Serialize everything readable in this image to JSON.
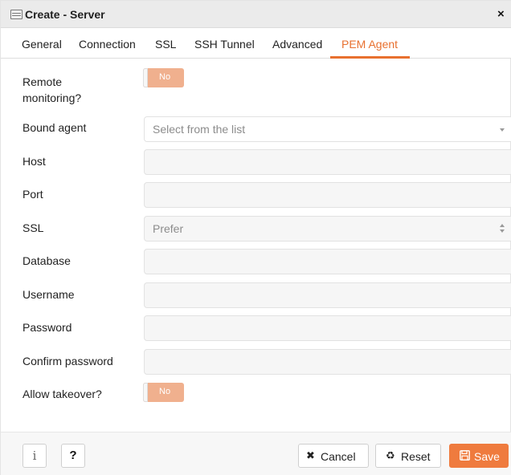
{
  "dialog": {
    "title": "Create - Server",
    "close_glyph": "×"
  },
  "tabs": [
    {
      "label": "General"
    },
    {
      "label": "Connection"
    },
    {
      "label": "SSL"
    },
    {
      "label": "SSH Tunnel"
    },
    {
      "label": "Advanced"
    },
    {
      "label": "PEM Agent",
      "active": true
    }
  ],
  "form": {
    "remote_monitoring": {
      "label_line1": "Remote",
      "label_line2": "monitoring?",
      "value": "No"
    },
    "bound_agent": {
      "label": "Bound agent",
      "placeholder": "Select from the list"
    },
    "host": {
      "label": "Host",
      "value": ""
    },
    "port": {
      "label": "Port",
      "value": ""
    },
    "ssl": {
      "label": "SSL",
      "value": "Prefer"
    },
    "database": {
      "label": "Database",
      "value": ""
    },
    "username": {
      "label": "Username",
      "value": ""
    },
    "password": {
      "label": "Password",
      "value": ""
    },
    "confirm_password": {
      "label": "Confirm password",
      "value": ""
    },
    "allow_takeover": {
      "label": "Allow takeover?",
      "value": "No"
    }
  },
  "footer": {
    "info_glyph": "i",
    "help_glyph": "?",
    "cancel": {
      "icon": "close-icon",
      "glyph": "✖",
      "label": "Cancel"
    },
    "reset": {
      "icon": "recycle-icon",
      "glyph": "♻",
      "label": "Reset"
    },
    "save": {
      "icon": "floppy-disk-icon",
      "label": "Save"
    }
  },
  "colors": {
    "accent": "#e8702f",
    "toggle_off": "#f0b08e",
    "save_button": "#ef7b3e"
  }
}
